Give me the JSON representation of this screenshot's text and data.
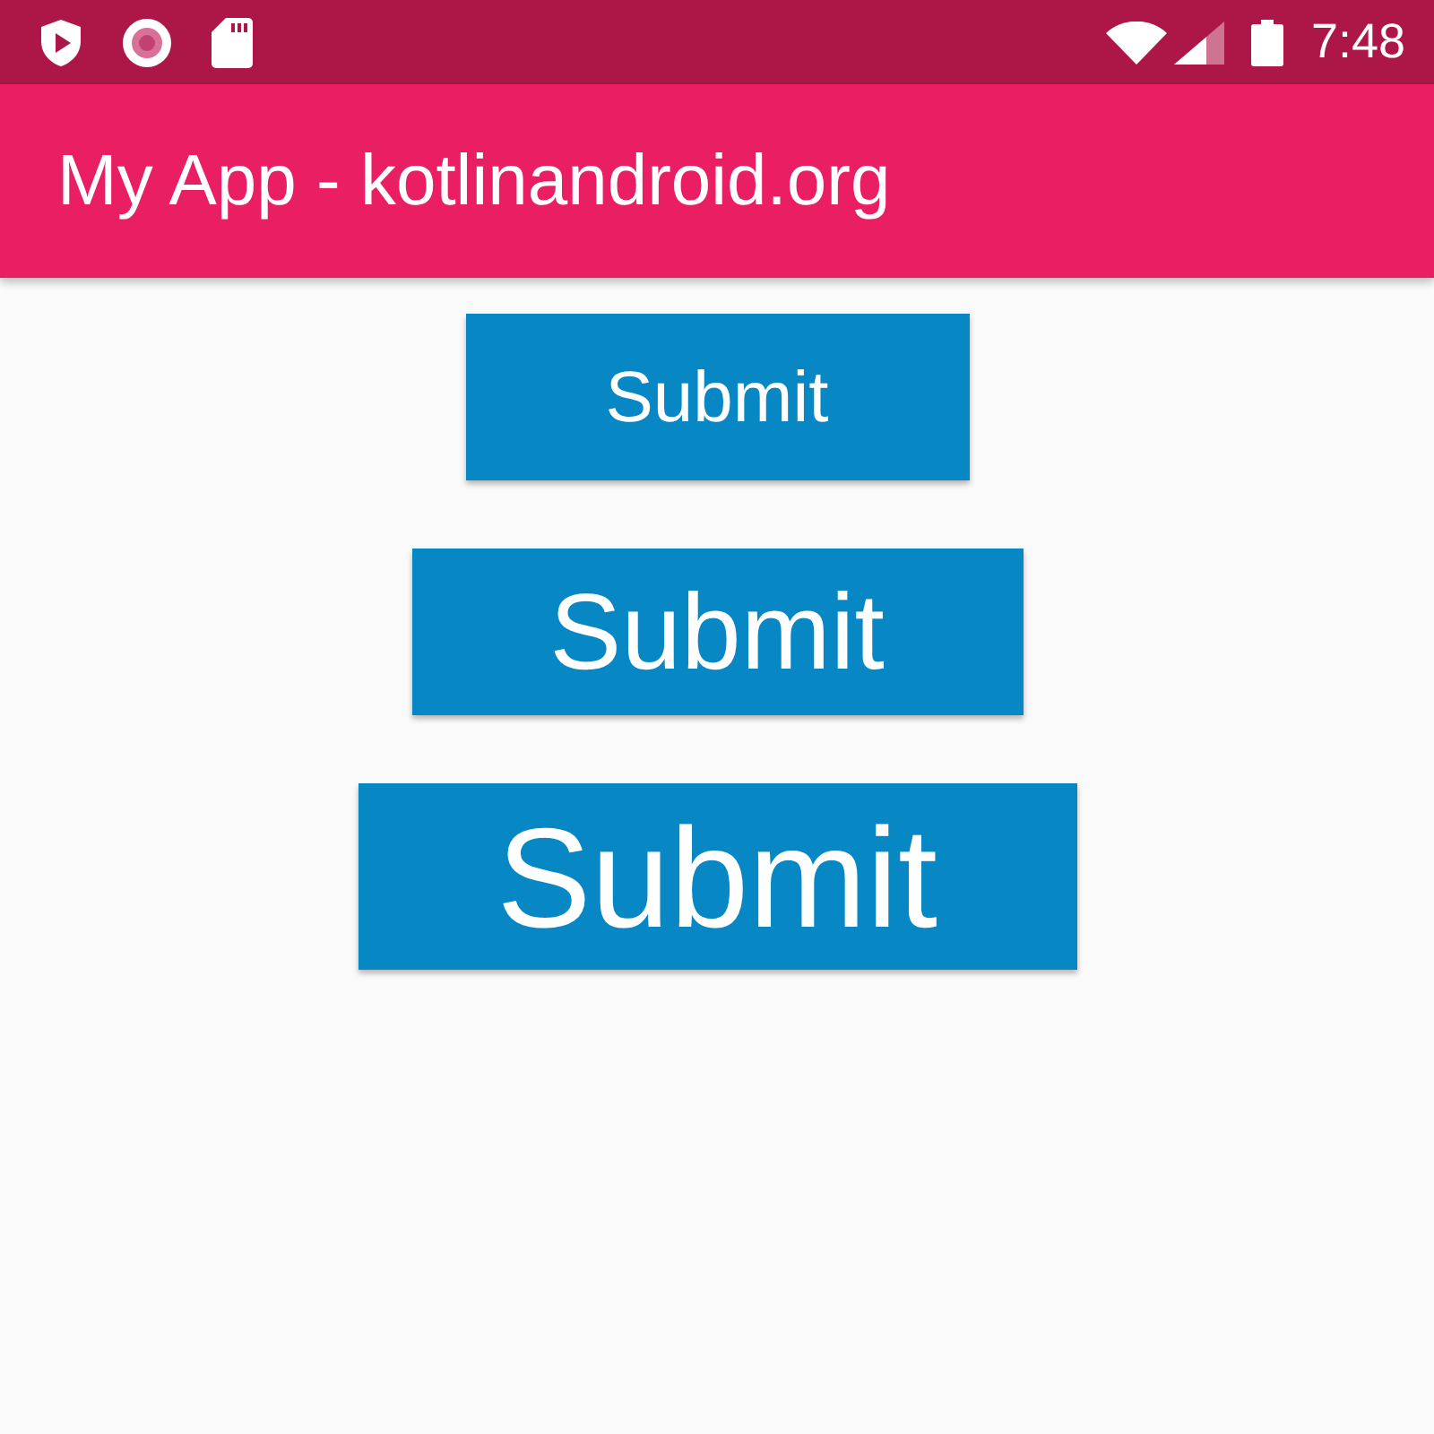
{
  "status_bar": {
    "time": "7:48"
  },
  "app_bar": {
    "title": "My App - kotlinandroid.org"
  },
  "buttons": [
    {
      "label": "Submit"
    },
    {
      "label": "Submit"
    },
    {
      "label": "Submit"
    }
  ]
}
